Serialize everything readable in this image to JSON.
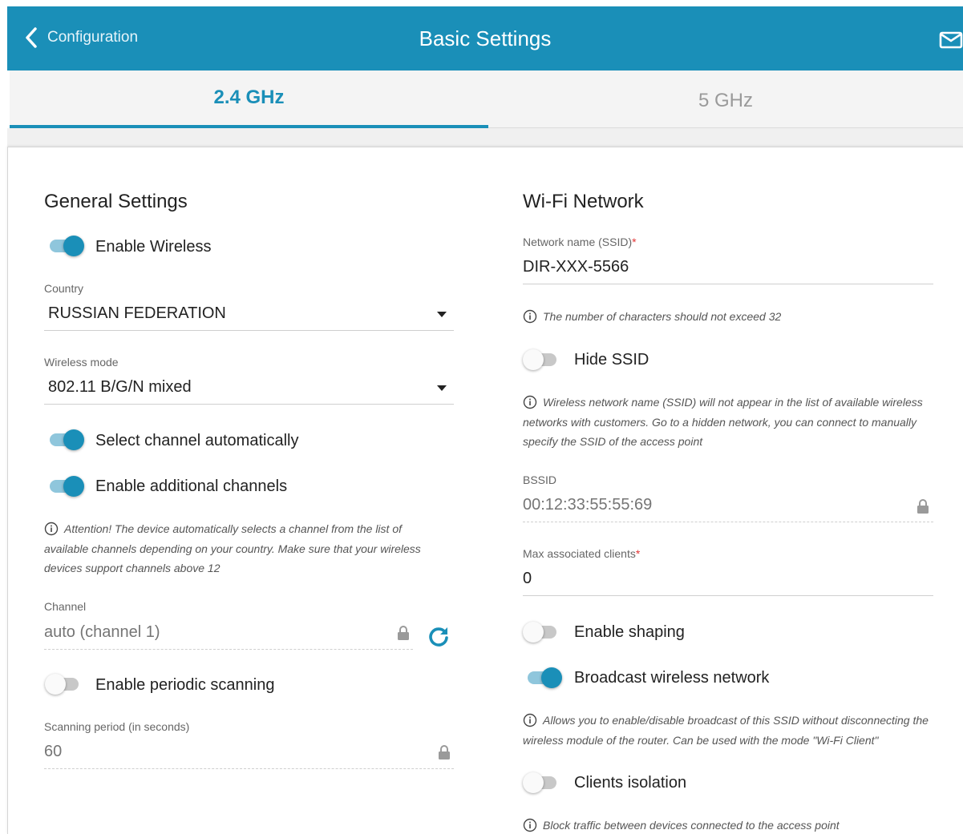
{
  "header": {
    "back_label": "Configuration",
    "title": "Basic Settings",
    "accent": "#1a8fb8"
  },
  "tabs": [
    {
      "label": "2.4 GHz",
      "active": true
    },
    {
      "label": "5 GHz",
      "active": false
    }
  ],
  "general": {
    "title": "General Settings",
    "enable_wireless": {
      "label": "Enable Wireless",
      "on": true
    },
    "country": {
      "label": "Country",
      "value": "RUSSIAN FEDERATION"
    },
    "wireless_mode": {
      "label": "Wireless mode",
      "value": "802.11 B/G/N mixed"
    },
    "select_channel_auto": {
      "label": "Select channel automatically",
      "on": true
    },
    "additional_channels": {
      "label": "Enable additional channels",
      "on": true
    },
    "attention_hint": "Attention! The device automatically selects a channel from the list of available channels depending on your country. Make sure that your wireless devices support channels above 12",
    "channel": {
      "label": "Channel",
      "value": "auto (channel 1)"
    },
    "periodic_scanning": {
      "label": "Enable periodic scanning",
      "on": false
    },
    "scanning_period": {
      "label": "Scanning period (in seconds)",
      "value": "60"
    }
  },
  "wifi": {
    "title": "Wi-Fi Network",
    "ssid": {
      "label": "Network name (SSID)",
      "required_mark": "*",
      "value": "DIR-XXX-5566"
    },
    "ssid_hint": "The number of characters should not exceed 32",
    "hide_ssid": {
      "label": "Hide SSID",
      "on": false
    },
    "hide_hint": "Wireless network name (SSID) will not appear in the list of available wireless networks with customers. Go to a hidden network, you can connect to manually specify the SSID of the access point",
    "bssid": {
      "label": "BSSID",
      "value": "00:12:33:55:55:69"
    },
    "max_clients": {
      "label": "Max associated clients",
      "required_mark": "*",
      "value": "0"
    },
    "enable_shaping": {
      "label": "Enable shaping",
      "on": false
    },
    "broadcast": {
      "label": "Broadcast wireless network",
      "on": true
    },
    "broadcast_hint": "Allows you to enable/disable broadcast of this SSID without disconnecting the wireless module of the router. Can be used with the mode \"Wi-Fi Client\"",
    "isolation": {
      "label": "Clients isolation",
      "on": false
    },
    "isolation_hint": "Block traffic between devices connected to the access point"
  }
}
